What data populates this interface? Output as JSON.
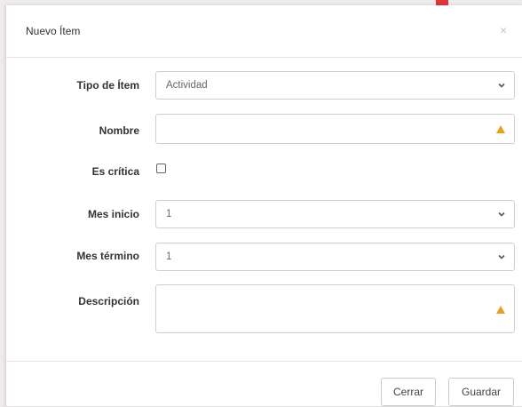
{
  "dialog": {
    "title": "Nuevo Ítem",
    "close_glyph": "×",
    "close_icon": "close-icon"
  },
  "annotation": {
    "icon": "arrow-down-icon",
    "color": "#e0343a"
  },
  "form": {
    "tipo": {
      "label": "Tipo de Ítem",
      "value": "Actividad",
      "icon": "chevron-down-icon"
    },
    "nombre": {
      "label": "Nombre",
      "value": "",
      "icon": "warning-icon"
    },
    "critica": {
      "label": "Es crítica",
      "checked": false
    },
    "mes_inicio": {
      "label": "Mes inicio",
      "value": "1",
      "icon": "chevron-down-icon"
    },
    "mes_termino": {
      "label": "Mes término",
      "value": "1",
      "icon": "chevron-down-icon"
    },
    "descripcion": {
      "label": "Descripción",
      "value": "",
      "icon": "warning-icon"
    }
  },
  "footer": {
    "close_label": "Cerrar",
    "save_label": "Guardar"
  },
  "colors": {
    "warning": "#e6a11f",
    "border": "#cfcfcf",
    "label_text": "#333333"
  }
}
